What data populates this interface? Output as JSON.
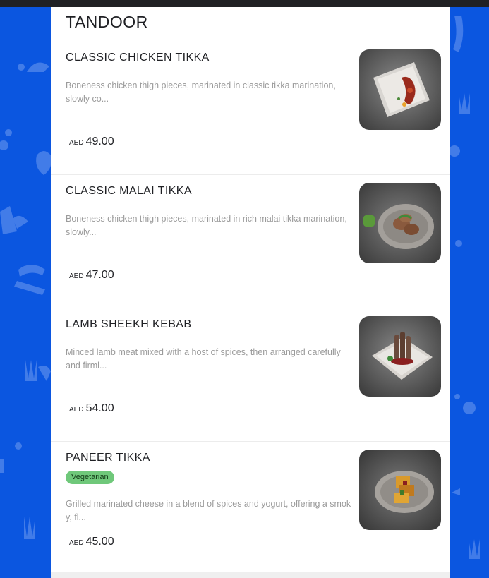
{
  "section": {
    "title": "TANDOOR"
  },
  "items": [
    {
      "name": "CLASSIC CHICKEN TIKKA",
      "description": "Boneness chicken thigh pieces, marinated in classic tikka marination, slowly co...",
      "currency": "AED",
      "price": "49.00",
      "badge": null,
      "image": "square white plate with chicken tikka"
    },
    {
      "name": "CLASSIC MALAI TIKKA",
      "description": "Boneness chicken thigh pieces, marinated in rich malai tikka marination, slowly...",
      "currency": "AED",
      "price": "47.00",
      "badge": null,
      "image": "oval grey plate with malai tikka and green chutney"
    },
    {
      "name": "LAMB SHEEKH KEBAB",
      "description": "Minced lamb meat mixed with a host of spices, then arranged carefully and firml...",
      "currency": "AED",
      "price": "54.00",
      "badge": null,
      "image": "square plate with stacked sheekh kebab"
    },
    {
      "name": "PANEER TIKKA",
      "description": "Grilled marinated cheese in a blend of spices and yogurt, offering a smok y, fl...",
      "currency": "AED",
      "price": "45.00",
      "badge": "Vegetarian",
      "image": "oval grey plate with paneer tikka"
    }
  ],
  "colors": {
    "background": "#0b56e0",
    "panel": "#ffffff",
    "badge": "#6fc87a",
    "description": "#9a9a9a"
  }
}
